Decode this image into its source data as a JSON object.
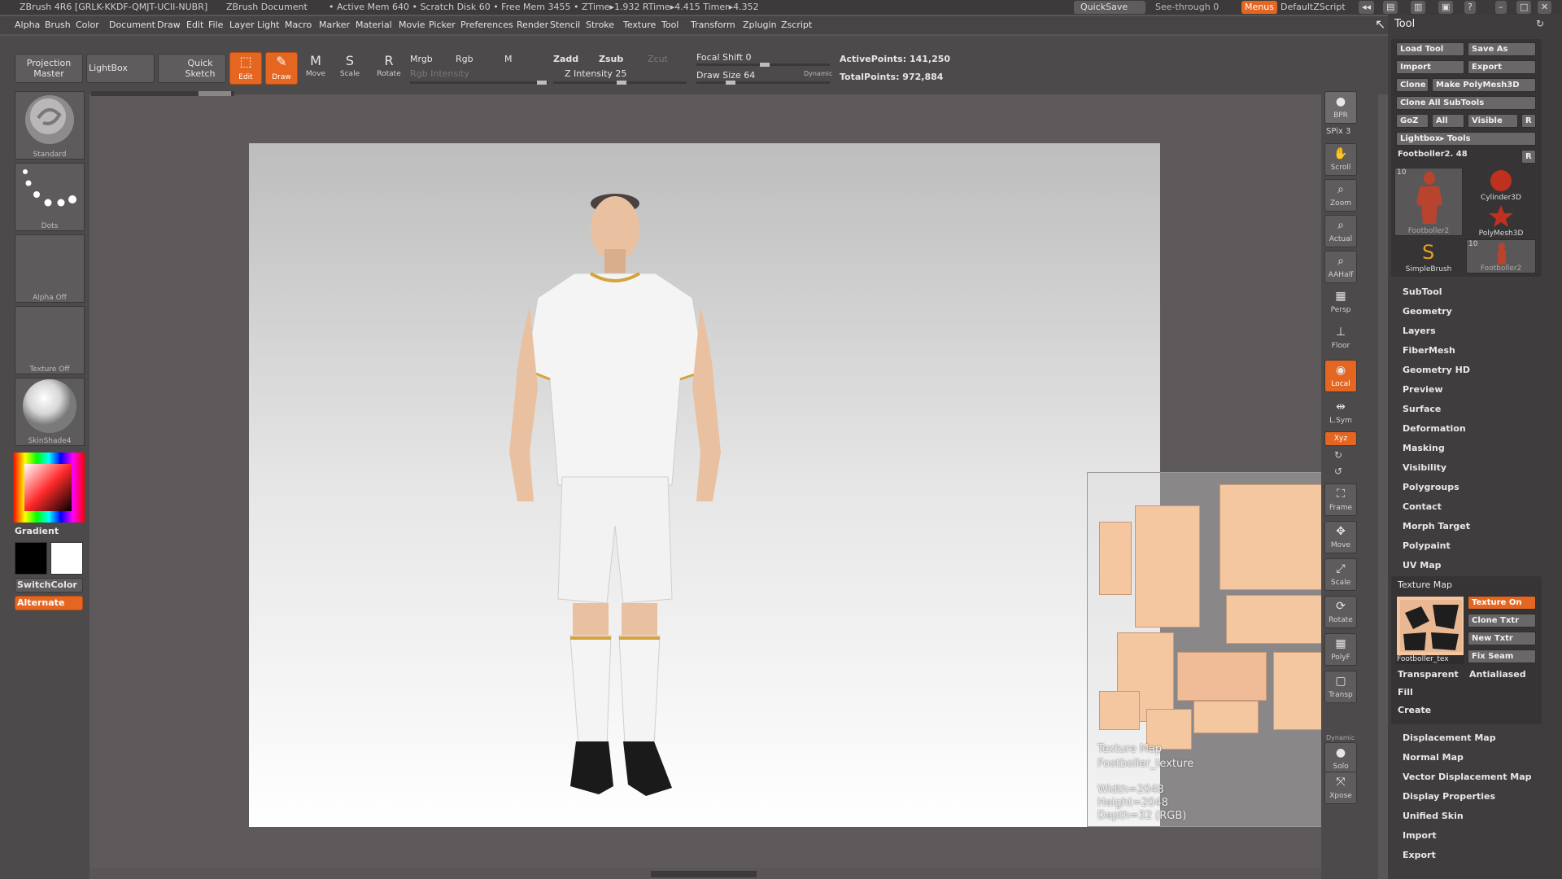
{
  "title_bar": {
    "app": "ZBrush 4R6 [GRLK-KKDF-QMJT-UCII-NUBR]",
    "doc": "ZBrush Document",
    "stats": "• Active Mem 640 • Scratch Disk 60 • Free Mem 3455 • ZTime▸1.932 RTime▸4.415 Timer▸4.352",
    "quicksave": "QuickSave",
    "see_through": "See-through  0",
    "menus": "Menus",
    "script": "DefaultZScript"
  },
  "menu": [
    "Alpha",
    "Brush",
    "Color",
    "Document",
    "Draw",
    "Edit",
    "File",
    "Layer",
    "Light",
    "Macro",
    "Marker",
    "Material",
    "Movie",
    "Picker",
    "Preferences",
    "Render",
    "Stencil",
    "Stroke",
    "Texture",
    "Tool",
    "Transform",
    "Zplugin",
    "Zscript"
  ],
  "shelf": {
    "projection_master": "Projection Master",
    "lightbox": "LightBox",
    "quick_sketch": "Quick Sketch",
    "edit": "Edit",
    "draw": "Draw",
    "move": "Move",
    "scale": "Scale",
    "rotate": "Rotate",
    "mrgb": "Mrgb",
    "rgb": "Rgb",
    "m": "M",
    "rgb_intensity": "Rgb Intensity",
    "zadd": "Zadd",
    "zsub": "Zsub",
    "zcut": "Zcut",
    "z_intensity": "Z Intensity 25",
    "focal_shift": "Focal Shift 0",
    "draw_size": "Draw Size 64",
    "dynamic": "Dynamic",
    "active_points": "ActivePoints: 141,250",
    "total_points": "TotalPoints: 972,884"
  },
  "left": {
    "standard": "Standard",
    "dots": "Dots",
    "alpha_off": "Alpha Off",
    "texture_off": "Texture Off",
    "skinshade": "SkinShade4",
    "gradient": "Gradient",
    "switchcolor": "SwitchColor",
    "alternate": "Alternate"
  },
  "right_shelf": {
    "bpr": "BPR",
    "spix": "SPix 3",
    "scroll": "Scroll",
    "zoom": "Zoom",
    "actual": "Actual",
    "aahalf": "AAHalf",
    "persp": "Persp",
    "floor": "Floor",
    "local": "Local",
    "lsym": "L.Sym",
    "xyz": "Xyz",
    "frame": "Frame",
    "move": "Move",
    "scale": "Scale",
    "rotate": "Rotate",
    "polyf": "PolyF",
    "transp": "Transp",
    "dynamic": "Dynamic",
    "solo": "Solo",
    "xpose": "Xpose"
  },
  "tool_panel": {
    "title": "Tool",
    "load_tool": "Load Tool",
    "save_as": "Save As",
    "import": "Import",
    "export": "Export",
    "clone": "Clone",
    "make_polymesh": "Make PolyMesh3D",
    "clone_all": "Clone All SubTools",
    "goz": "GoZ",
    "all": "All",
    "visible": "Visible",
    "r": "R",
    "lightbox_tools": "Lightbox▸ Tools",
    "current_tool": "Footboller2. 48",
    "thumbs": [
      "Footboller2",
      "Cylinder3D",
      "PolyMesh3D",
      "SimpleBrush",
      "Footboller2"
    ],
    "thumb_count": "10",
    "items": [
      "SubTool",
      "Geometry",
      "Layers",
      "FiberMesh",
      "Geometry HD",
      "Preview",
      "Surface",
      "Deformation",
      "Masking",
      "Visibility",
      "Polygroups",
      "Contact",
      "Morph Target",
      "Polypaint",
      "UV Map"
    ],
    "texture_map": {
      "title": "Texture Map",
      "texture_on": "Texture On",
      "clone_txtr": "Clone Txtr",
      "new_txtr": "New Txtr",
      "fix_seam": "Fix Seam",
      "transparent": "Transparent",
      "antialiased": "Antialiased",
      "fill": "Fill",
      "create": "Create",
      "thumb_label": "Footboller_tex"
    },
    "items2": [
      "Displacement Map",
      "Normal Map",
      "Vector Displacement Map",
      "Display Properties",
      "Unified Skin",
      "Import",
      "Export"
    ]
  },
  "texture_popup": {
    "title": "Texture Map",
    "name": "Footboller_texture",
    "width": "Width=2048",
    "height": "Height=2048",
    "depth": "Depth=32 (RGB)"
  }
}
